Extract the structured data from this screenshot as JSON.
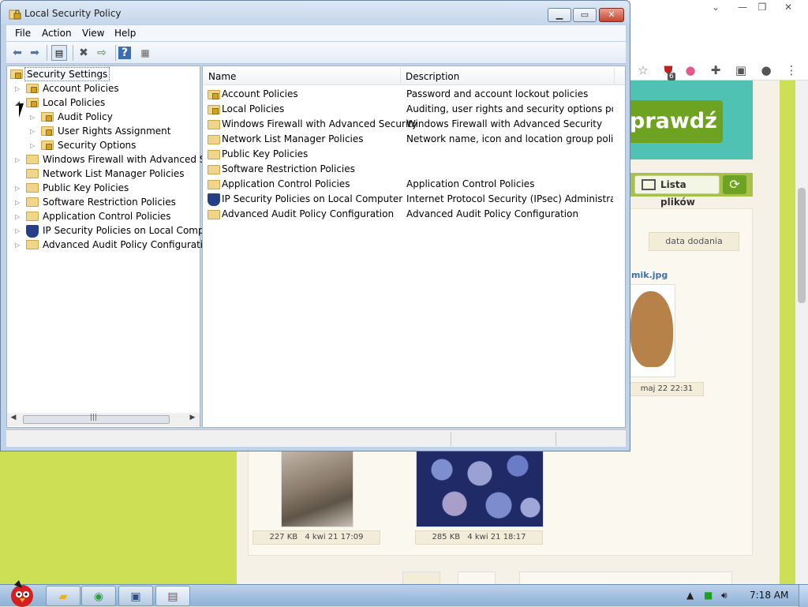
{
  "mmc": {
    "title": "Local Security Policy",
    "menu": [
      "File",
      "Action",
      "View",
      "Help"
    ],
    "toolbar_icons": [
      "back-icon",
      "forward-icon",
      "show-hide-tree-icon",
      "delete-icon",
      "export-list-icon",
      "help-icon",
      "properties-icon"
    ],
    "tree": {
      "root": "Security Settings",
      "items": [
        {
          "label": "Account Policies",
          "level": 1,
          "expander": "collapsed",
          "icon": "lock-folder"
        },
        {
          "label": "Local Policies",
          "level": 1,
          "expander": "expanded",
          "icon": "lock-folder"
        },
        {
          "label": "Audit Policy",
          "level": 2,
          "expander": "collapsed",
          "icon": "lock-folder"
        },
        {
          "label": "User Rights Assignment",
          "level": 2,
          "expander": "collapsed",
          "icon": "lock-folder"
        },
        {
          "label": "Security Options",
          "level": 2,
          "expander": "collapsed",
          "icon": "lock-folder"
        },
        {
          "label": "Windows Firewall with Advanced Secu",
          "level": 1,
          "expander": "collapsed",
          "icon": "folder"
        },
        {
          "label": "Network List Manager Policies",
          "level": 1,
          "expander": "none",
          "icon": "folder"
        },
        {
          "label": "Public Key Policies",
          "level": 1,
          "expander": "collapsed",
          "icon": "folder"
        },
        {
          "label": "Software Restriction Policies",
          "level": 1,
          "expander": "collapsed",
          "icon": "folder"
        },
        {
          "label": "Application Control Policies",
          "level": 1,
          "expander": "collapsed",
          "icon": "folder"
        },
        {
          "label": "IP Security Policies on Local Compute",
          "level": 1,
          "expander": "collapsed",
          "icon": "ipsec-shield"
        },
        {
          "label": "Advanced Audit Policy Configuration",
          "level": 1,
          "expander": "collapsed",
          "icon": "folder"
        }
      ],
      "scroll_glyph": "|||"
    },
    "list": {
      "columns": [
        "Name",
        "Description"
      ],
      "rows": [
        {
          "name": "Account Policies",
          "description": "Password and account lockout policies",
          "icon": "lock-folder"
        },
        {
          "name": "Local Policies",
          "description": "Auditing, user rights and security options polici...",
          "icon": "lock-folder"
        },
        {
          "name": "Windows Firewall with Advanced Security",
          "description": "Windows Firewall with Advanced Security",
          "icon": "folder"
        },
        {
          "name": "Network List Manager Policies",
          "description": "Network name, icon and location group policies.",
          "icon": "folder"
        },
        {
          "name": "Public Key Policies",
          "description": "",
          "icon": "folder"
        },
        {
          "name": "Software Restriction Policies",
          "description": "",
          "icon": "folder"
        },
        {
          "name": "Application Control Policies",
          "description": "Application Control Policies",
          "icon": "folder"
        },
        {
          "name": "IP Security Policies on Local Computer",
          "description": "Internet Protocol Security (IPsec) Administratio...",
          "icon": "ipsec-shield"
        },
        {
          "name": "Advanced Audit Policy Configuration",
          "description": "Advanced Audit Policy Configuration",
          "icon": "folder"
        }
      ]
    }
  },
  "browser": {
    "ext_badge": "6",
    "site": {
      "button_text": "prawdź",
      "lista_label": "Lista plików",
      "data_header": "data dodania",
      "file_link": "mik.jpg",
      "hamster_caption": "maj 22 22:31",
      "cat_caption_size": "227 KB",
      "cat_caption_date": "4 kwi 21 17:09",
      "stones_caption_size": "285 KB",
      "stones_caption_date": "4 kwi 21 18:17"
    }
  },
  "taskbar": {
    "clock": "7:18 AM",
    "apps": [
      "file-explorer-icon",
      "chrome-icon",
      "network-computer-icon",
      "security-policy-icon"
    ]
  }
}
